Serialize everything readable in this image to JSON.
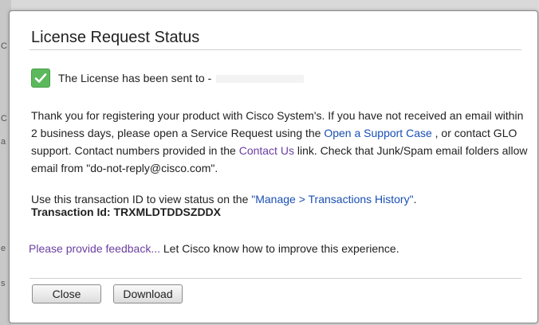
{
  "dialog": {
    "title": "License Request Status",
    "sent_message": "The License has been sent to -",
    "body": {
      "part1": "Thank you for registering your product with Cisco System's. If you have not received an email within 2 business days, please open a Service Request using the ",
      "support_link": "Open a Support Case",
      "part2": " , or contact GLO support. Contact numbers provided in the ",
      "contact_link": "Contact Us",
      "part3": " link. Check that Junk/Spam email folders allow email from \"do-not-reply@cisco.com\"."
    },
    "transaction": {
      "prefix": "Use this transaction ID to view status on the ",
      "history_link": "\"Manage > Transactions History\"",
      "suffix": ".",
      "id_line": "Transaction Id: TRXMLDTDDSZDDX"
    },
    "feedback": {
      "link": "Please provide feedback...",
      "text": " Let Cisco know how to improve this experience."
    },
    "buttons": {
      "close": "Close",
      "download": "Download"
    }
  },
  "backdrop": {
    "chars": [
      "C",
      "C",
      "a",
      "e",
      "s"
    ]
  },
  "colors": {
    "link": "#1a4fb3",
    "feedback_link": "#6b3fa0",
    "success": "#5cb85c"
  },
  "icons": {
    "success": "checkmark-icon"
  }
}
